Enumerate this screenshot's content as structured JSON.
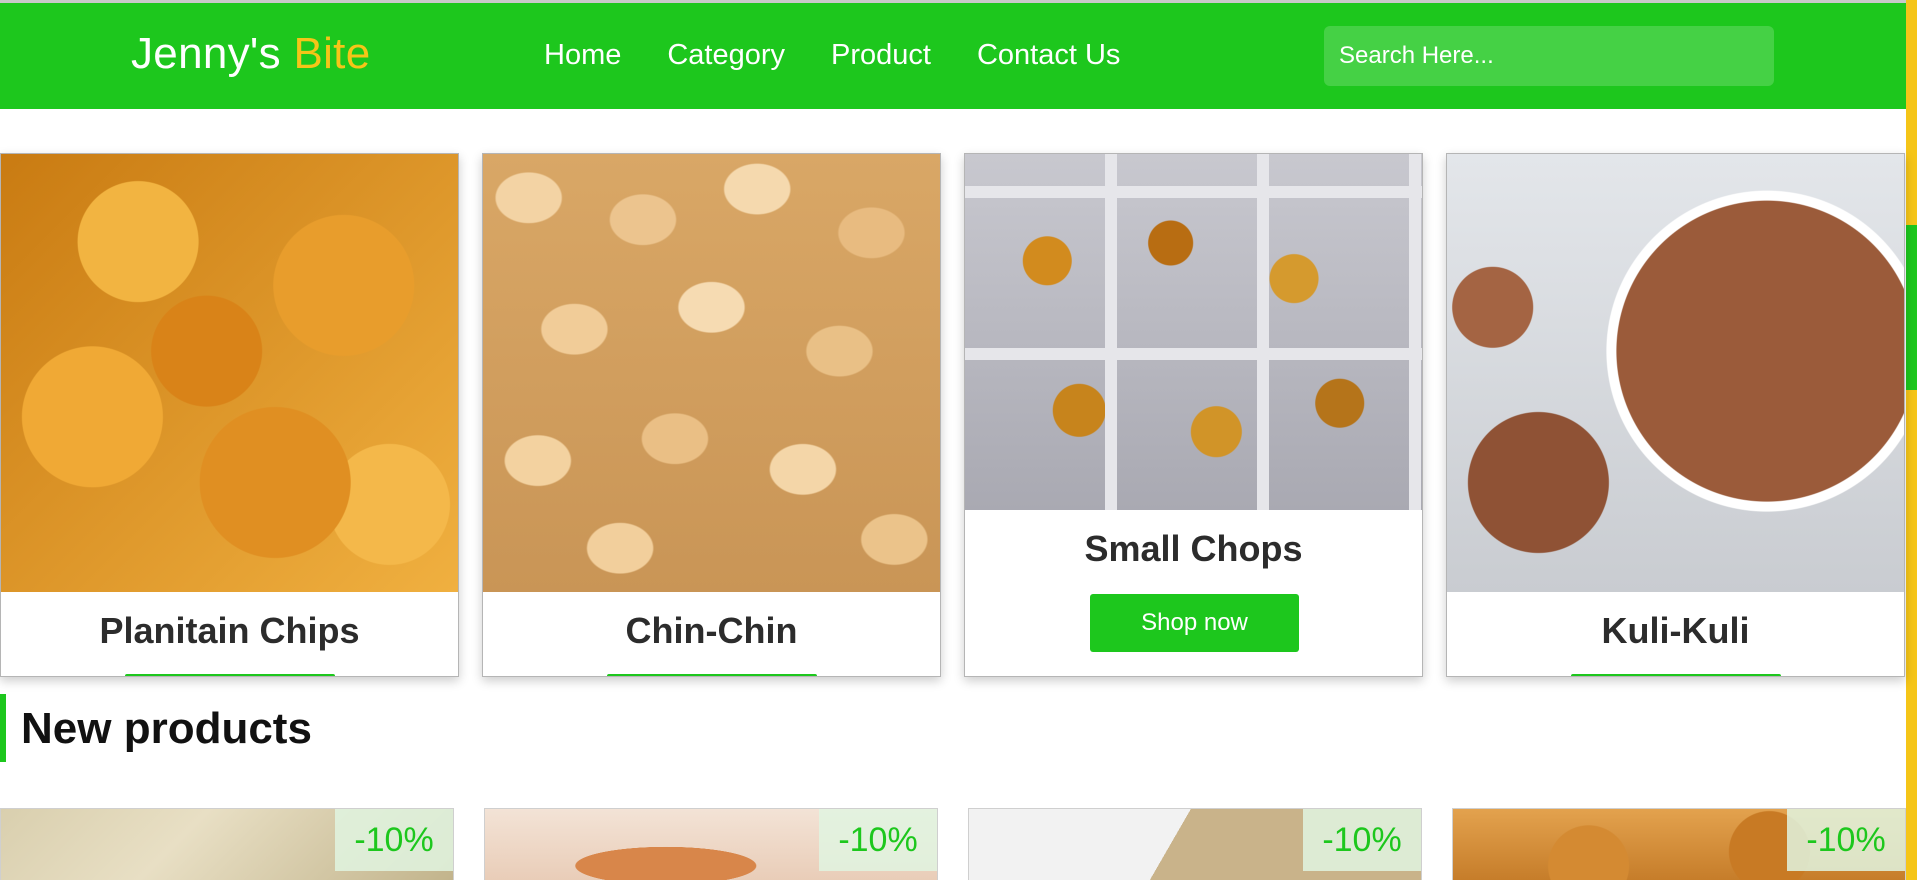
{
  "brand": {
    "name": "Jenny's",
    "accent": "Bite",
    "primary_color": "#1dc71d",
    "accent_color": "#f5c518"
  },
  "nav": {
    "items": [
      "Home",
      "Category",
      "Product",
      "Contact Us"
    ]
  },
  "search": {
    "placeholder": "Search Here..."
  },
  "categories": [
    {
      "title": "Planitain Chips"
    },
    {
      "title": "Chin-Chin"
    },
    {
      "title": "Small Chops",
      "button": "Shop now"
    },
    {
      "title": "Kuli-Kuli"
    }
  ],
  "new_products": {
    "heading": "New products",
    "items": [
      {
        "discount": "-10%"
      },
      {
        "discount": "-10%"
      },
      {
        "discount": "-10%"
      },
      {
        "discount": "-10%"
      }
    ]
  }
}
